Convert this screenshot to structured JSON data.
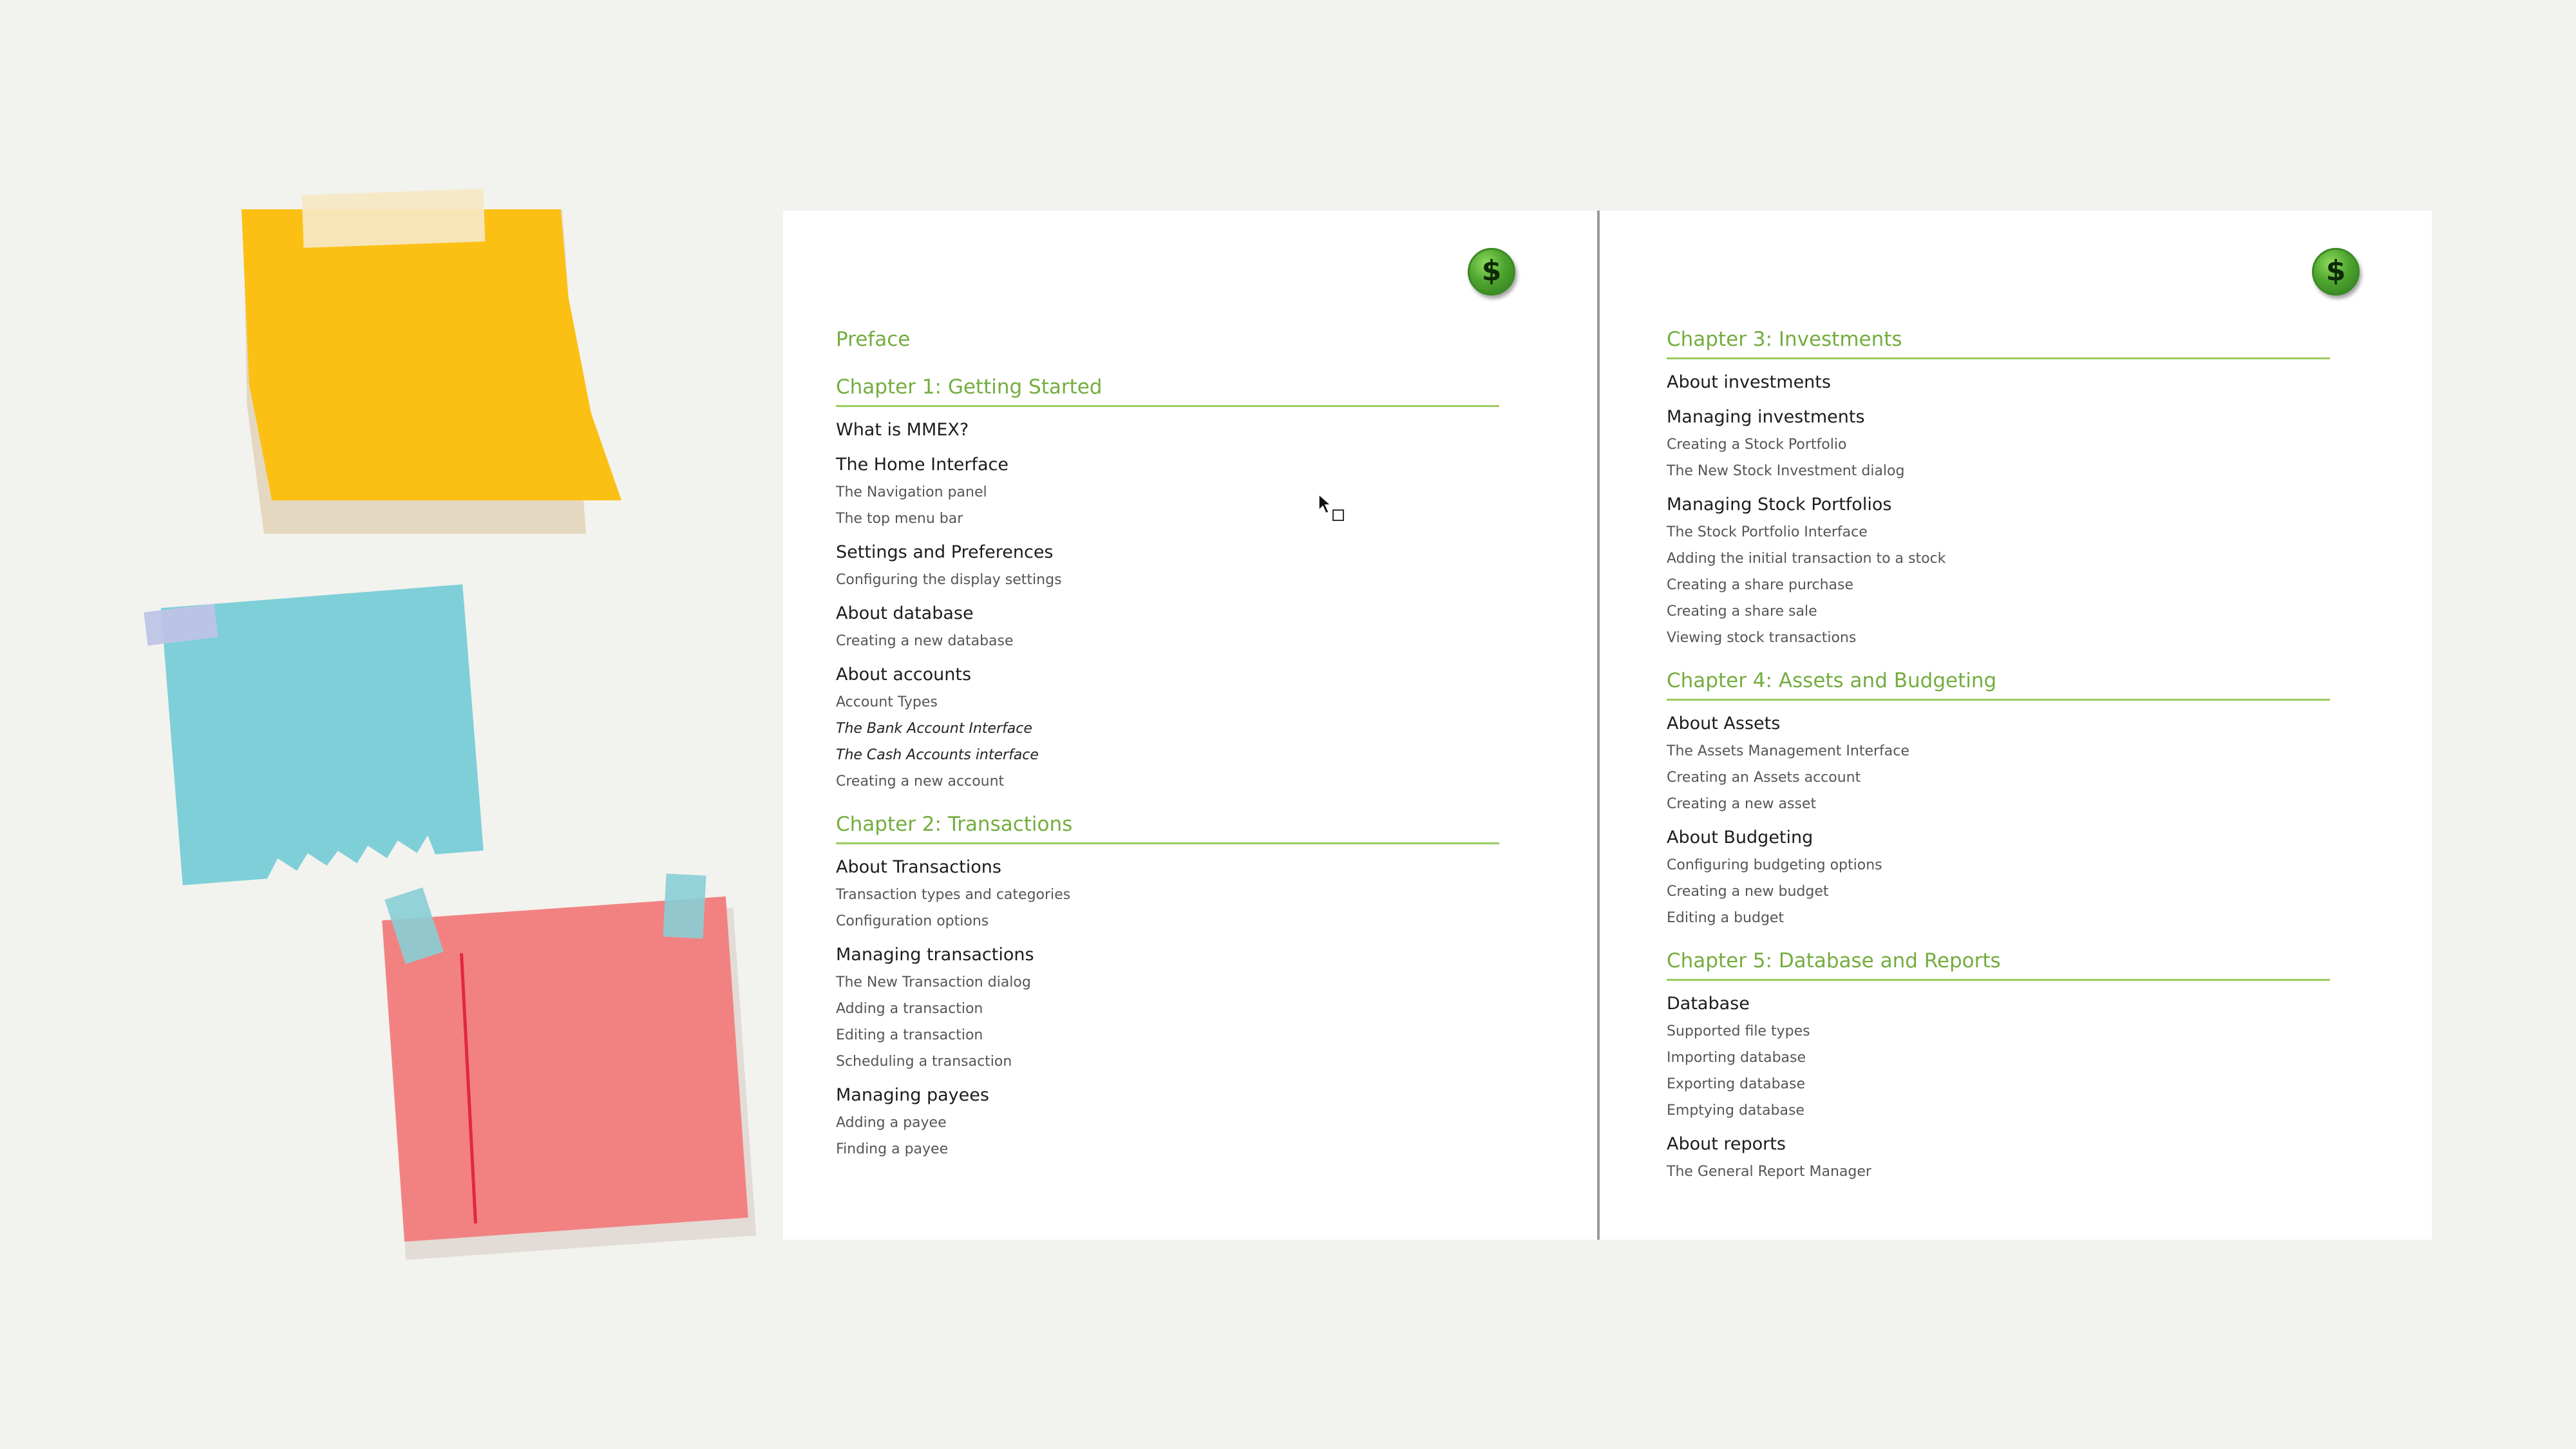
{
  "colors": {
    "background": "#f2f2ee",
    "chapter_accent": "#74ad3f",
    "rule": "#9acc5d",
    "coin": "#4fa52f"
  },
  "coin_symbol": "$",
  "left_page": {
    "chapters": [
      {
        "title": "Preface",
        "sections": []
      },
      {
        "title": "Chapter 1: Getting Started",
        "sections": [
          {
            "title": "What is MMEX?",
            "items": []
          },
          {
            "title": "The Home Interface",
            "items": [
              "The Navigation panel",
              "The top menu bar"
            ]
          },
          {
            "title": "Settings and Preferences",
            "items": [
              "Configuring the display settings"
            ]
          },
          {
            "title": "About database",
            "items": [
              "Creating a new database"
            ]
          },
          {
            "title": "About accounts",
            "items": [
              "Account Types",
              "The Bank Account Interface",
              "The Cash Accounts interface",
              "Creating a new account"
            ]
          }
        ]
      },
      {
        "title": "Chapter 2: Transactions",
        "sections": [
          {
            "title": "About Transactions",
            "items": [
              "Transaction types and categories",
              "Configuration options"
            ]
          },
          {
            "title": "Managing transactions",
            "items": [
              "The New Transaction dialog",
              "Adding a transaction",
              "Editing a transaction",
              "Scheduling a transaction"
            ]
          },
          {
            "title": "Managing payees",
            "items": [
              "Adding a payee",
              "Finding a payee"
            ]
          }
        ]
      }
    ]
  },
  "right_page": {
    "chapters": [
      {
        "title": "Chapter 3: Investments",
        "sections": [
          {
            "title": "About investments",
            "items": []
          },
          {
            "title": "Managing investments",
            "items": [
              "Creating a Stock Portfolio",
              "The New Stock Investment dialog"
            ]
          },
          {
            "title": "Managing Stock Portfolios",
            "items": [
              "The Stock Portfolio Interface",
              "Adding the initial transaction to a stock",
              "Creating a share purchase",
              "Creating a share sale",
              "Viewing stock transactions"
            ]
          }
        ]
      },
      {
        "title": "Chapter 4: Assets and Budgeting",
        "sections": [
          {
            "title": "About Assets",
            "items": [
              "The Assets Management Interface",
              "Creating an Assets account",
              "Creating a new asset"
            ]
          },
          {
            "title": "About Budgeting",
            "items": [
              "Configuring budgeting options",
              "Creating a new budget",
              "Editing a budget"
            ]
          }
        ]
      },
      {
        "title": "Chapter 5: Database and Reports",
        "sections": [
          {
            "title": "Database",
            "items": [
              "Supported file types",
              "Importing database",
              "Exporting database",
              "Emptying database"
            ]
          },
          {
            "title": "About reports",
            "items": [
              "The General Report Manager"
            ]
          }
        ]
      }
    ]
  }
}
